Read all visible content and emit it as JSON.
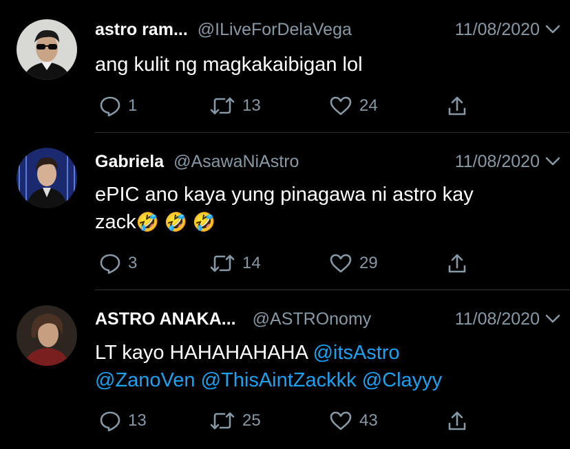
{
  "accent_color": "#1da1f2",
  "muted_color": "#8899a6",
  "tweets": [
    {
      "name": "astro ram...",
      "handle": "@ILiveForDelaVega",
      "date": "11/08/2020",
      "text": "ang kulit ng magkakaibigan lol",
      "replies": "1",
      "retweets": "13",
      "likes": "24"
    },
    {
      "name": "Gabriela",
      "handle": "@AsawaNiAstro",
      "date": "11/08/2020",
      "text_line1": "ePIC ano kaya yung pinagawa ni astro kay",
      "text_line2": "zack",
      "emojis": "🤣 🤣 🤣",
      "replies": "3",
      "retweets": "14",
      "likes": "29"
    },
    {
      "name": "ASTRO ANAKA...",
      "handle": "@ASTROnomy",
      "date": "11/08/2020",
      "text": "LT kayo HAHAHAHAHA",
      "mentions": [
        "@itsAstro",
        "@ZanoVen",
        "@ThisAintZackkk",
        "@Clayyy"
      ],
      "replies": "13",
      "retweets": "25",
      "likes": "43"
    }
  ]
}
